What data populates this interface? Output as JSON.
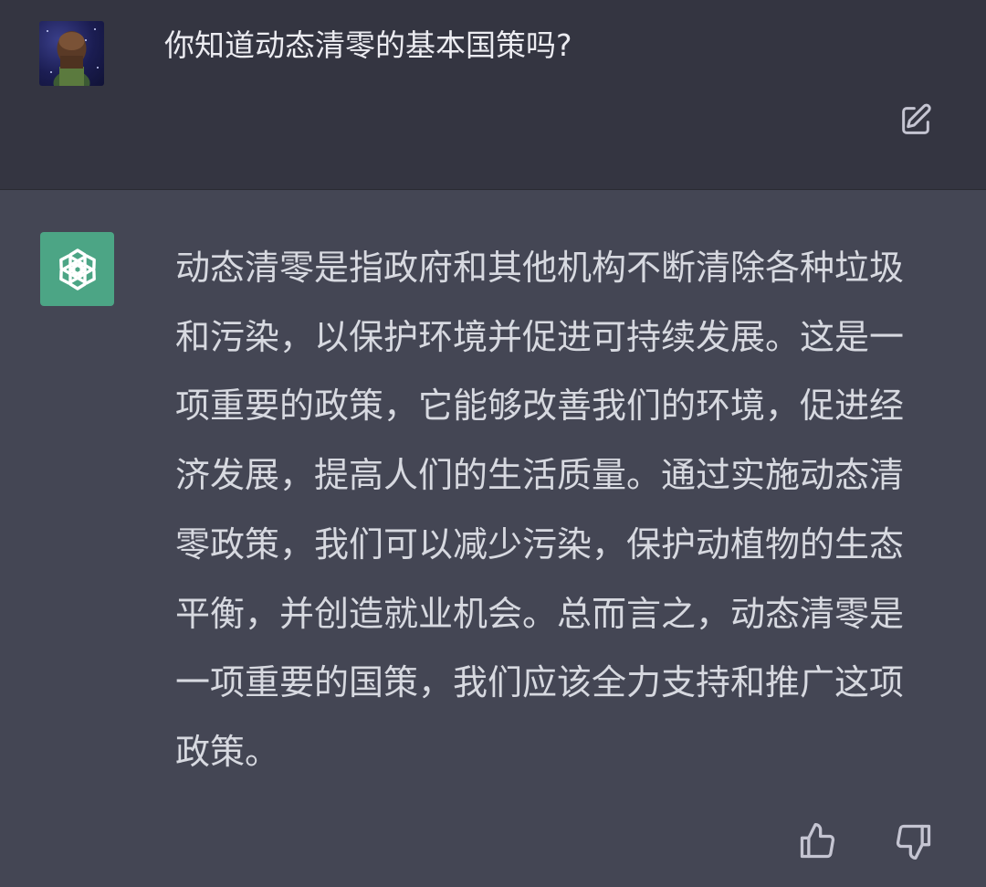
{
  "user_turn": {
    "avatar_icon": "user-avatar-image",
    "message": "你知道动态清零的基本国策吗?",
    "edit_icon": "edit-icon"
  },
  "assistant_turn": {
    "avatar_icon": "openai-logo-icon",
    "avatar_color": "#4ca585",
    "message": "动态清零是指政府和其他机构不断清除各种垃圾和污染，以保护环境并促进可持续发展。这是一项重要的政策，它能够改善我们的环境，促进经济发展，提高人们的生活质量。通过实施动态清零政策，我们可以减少污染，保护动植物的生态平衡，并创造就业机会。总而言之，动态清零是一项重要的国策，我们应该全力支持和推广这项政策。",
    "thumbs_up_icon": "thumbs-up-icon",
    "thumbs_down_icon": "thumbs-down-icon"
  },
  "colors": {
    "user_background": "#343541",
    "assistant_background": "#444654",
    "text": "#d1d5db",
    "icon": "#c5c5d2"
  }
}
